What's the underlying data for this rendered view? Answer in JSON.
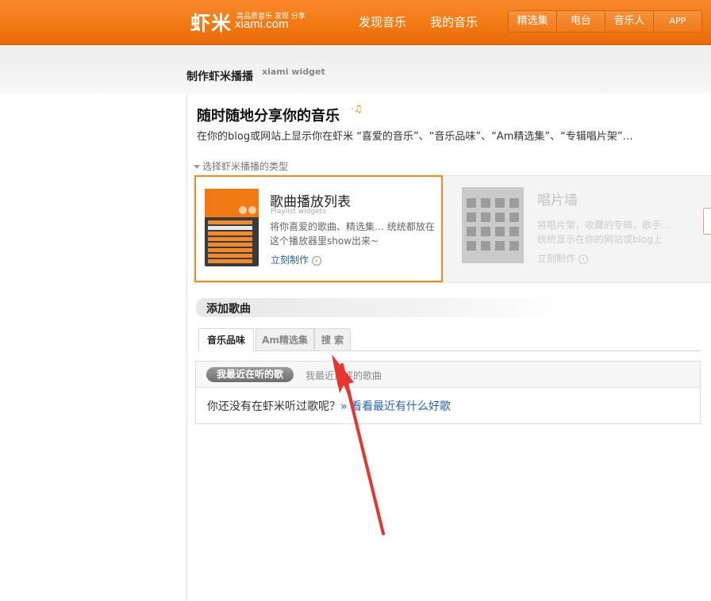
{
  "header": {
    "logo_cn": "虾米",
    "logo_slogan": "高品质音乐 发现 分享",
    "logo_domain": "xiami.com",
    "nav": [
      "发现音乐",
      "我的音乐"
    ],
    "sub_nav": [
      "精选集",
      "电台",
      "音乐人",
      "APP"
    ]
  },
  "page": {
    "title": "制作虾米播播",
    "subtitle": "xiami widget"
  },
  "intro": {
    "headline": "随时随地分享你的音乐",
    "text": "在你的blog或网站上显示你在虾米 “喜爱的音乐”、“音乐品味”、“Am精选集”、“专辑唱片架”…"
  },
  "types": {
    "caption": "选择虾米播播的类型",
    "playlist": {
      "title": "歌曲播放列表",
      "en": "Playlist widgets",
      "desc": "将你喜爱的歌曲、精选集… 统统都放在这个播放器里show出来~",
      "link": "立刻制作"
    },
    "wall": {
      "title": "唱片墙",
      "desc_line1": "将唱片架，收藏的专辑，歌手…",
      "desc_line2": "统统显示在你的网站或blog上",
      "link": "立刻制作"
    }
  },
  "add_songs": {
    "title": "添加歌曲",
    "tabs": [
      "音乐品味",
      "Am精选集",
      "搜 索"
    ],
    "active_tab": 0,
    "sub_tabs": [
      "我最近在听的歌",
      "我最近点评的歌曲"
    ],
    "empty_message": "你还没有在虾米听过歌呢？",
    "empty_link": "» 看看最近有什么好歌"
  },
  "colors": {
    "brand_orange": "#f27a14",
    "link_blue": "#2a64b0",
    "annotation_red": "#e8352f"
  }
}
